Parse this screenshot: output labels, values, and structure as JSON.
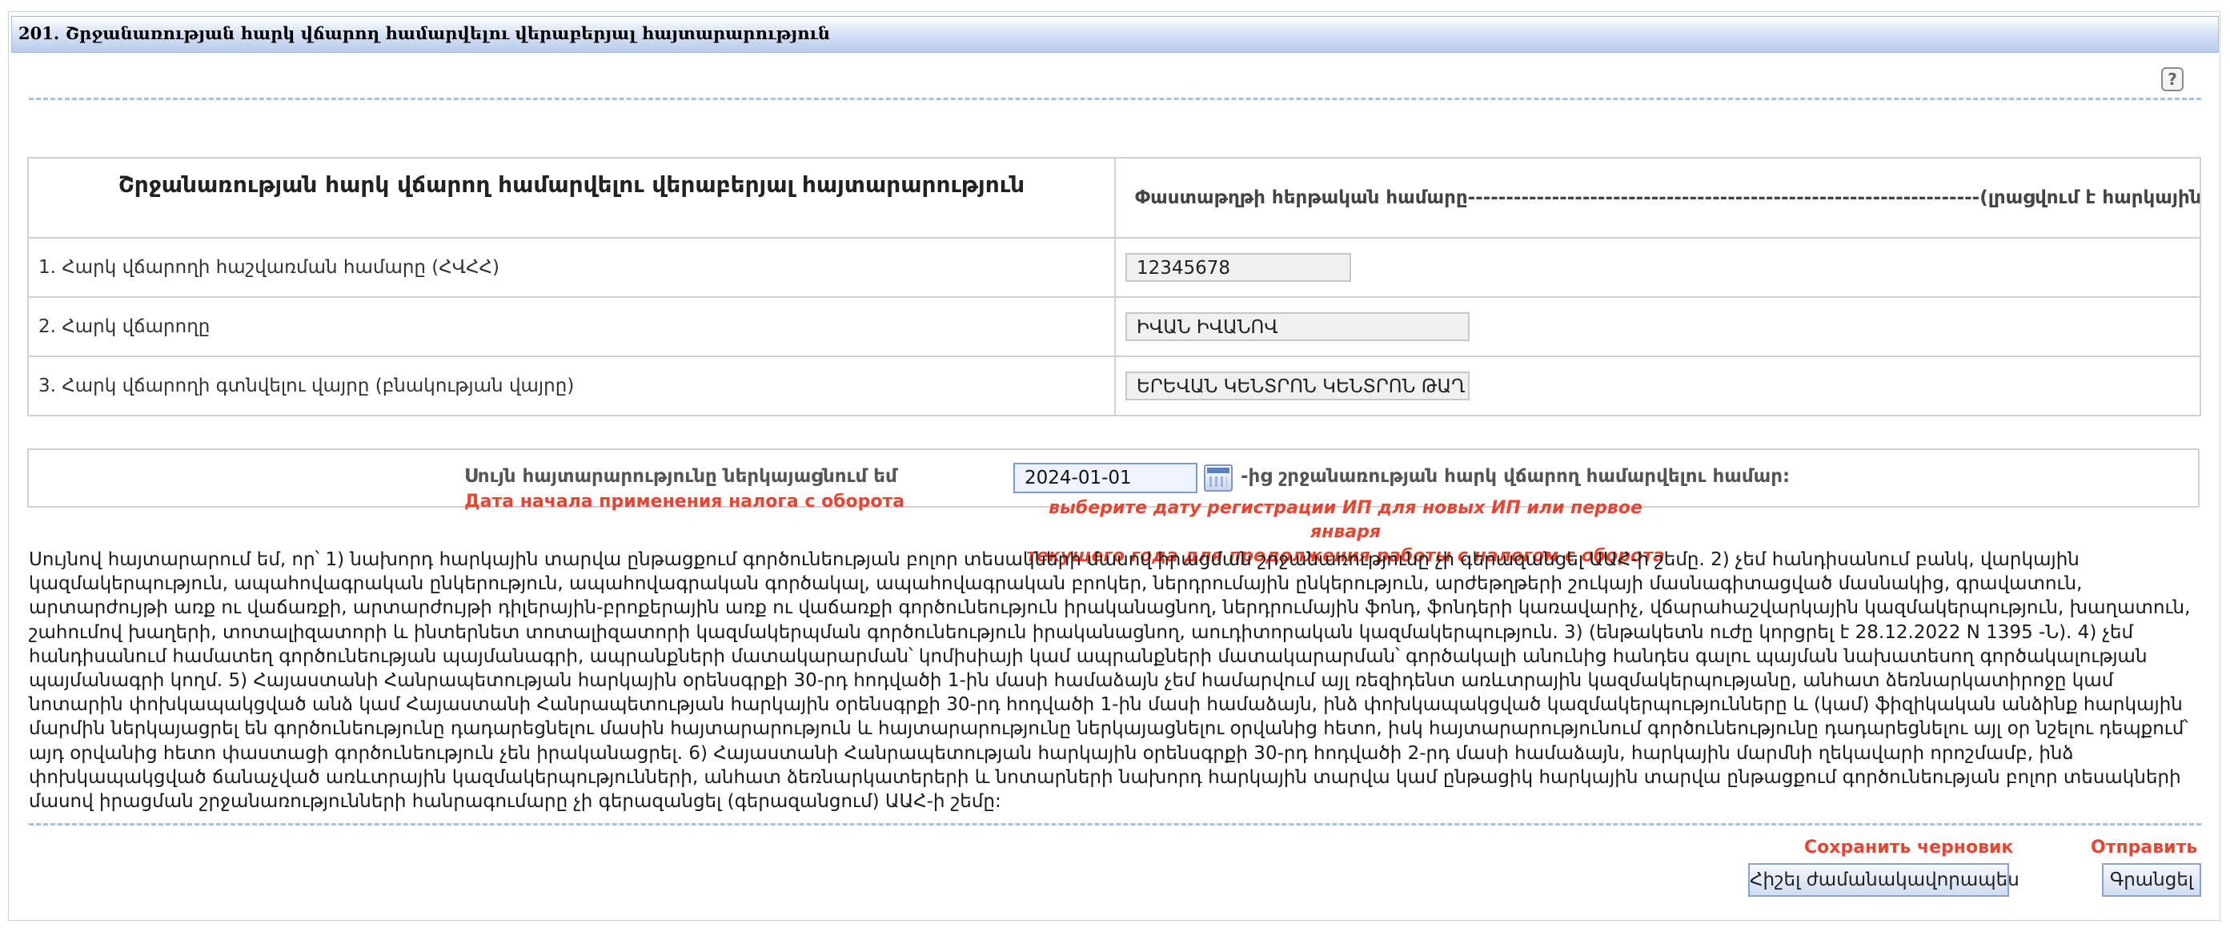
{
  "header": {
    "title": "201. Շրջանառության հարկ վճարող համարվելու վերաբերյալ հայտարարություն"
  },
  "help_icon": "question-help-icon",
  "form": {
    "heading": "Շրջանառության հարկ վճարող համարվելու վերաբերյալ հայտարարություն",
    "document_number_label": "Փաստաթղթի հերթական համարը-------------------------------------------------------------------(լրացվում է հարկային մարմնի կողմից)",
    "rows": [
      {
        "label": "1. Հարկ վճարողի հաշվառման համարը (ՀՎՀՀ)",
        "value": "12345678"
      },
      {
        "label": "2. Հարկ վճարողը",
        "value": "ԻՎԱՆ ԻՎԱՆՈՎ"
      },
      {
        "label": "3. Հարկ վճարողի գտնվելու վայրը (բնակության վայրը)",
        "value": "ԵՐԵՎԱՆ ԿԵՆՏՐՈՆ ԿԵՆՏՐՈՆ ԹԱՂ"
      }
    ]
  },
  "declaration": {
    "label": "Սույն հայտարարությունը ներկայացնում եմ",
    "label_hint": "Дата начала применения налога с оборота",
    "date_value": "2024-01-01",
    "date_suffix": "-ից շրջանառության հարկ վճարող համարվելու համար:",
    "date_hint_line1": "выберите дату регистрации ИП для новых ИП или первое января",
    "date_hint_line2": "текущего года для продолжения работы с налогом с оборота"
  },
  "confirmation_text": "Սույնով հայտարարում եմ, որ՝ 1) նախորդ հարկային տարվա ընթացքում գործունեության բոլոր տեսակների մասով իրացման շրջանառությունը չի գերազանցել ԱԱՀ-ի շեմը. 2) չեմ հանդիսանում բանկ, վարկային կազմակերպություն, ապահովագրական ընկերություն, ապահովագրական գործակալ, ապահովագրական բրոկեր, ներդրումային ընկերություն, արժեթղթերի շուկայի մասնագիտացված մասնակից, գրավատուն, արտարժույթի առք ու վաճառքի, արտարժույթի դիլերային-բրոքերային առք ու վաճառքի գործունեություն իրականացնող, ներդրումային ֆոնդ, ֆոնդերի կառավարիչ, վճարահաշվարկային կազմակերպություն, խաղատուն, շահումով խաղերի, տոտալիզատորի և ինտերնետ տոտալիզատորի կազմակերպման գործունեություն իրականացնող, աուդիտորական կազմակերպություն. 3) (ենթակետն ուժը կորցրել է 28.12.2022 N 1395 -Ն). 4) չեմ հանդիսանում համատեղ գործունեության պայմանագրի, ապրանքների մատակարարման՝ կոմիսիայի կամ ապրանքների մատակարարման՝ գործակալի անունից հանդես գալու պայման նախատեսող գործակալության պայմանագրի կողմ. 5) Հայաստանի Հանրապետության հարկային օրենսգրքի 30-րդ հոդվածի 1-ին մասի համաձայն չեմ համարվում այլ ռեզիդենտ առևտրային կազմակերպությանը, անհատ ձեռնարկատիրոջը կամ նոտարին փոխկապակցված անձ կամ Հայաստանի Հանրապետության հարկային օրենսգրքի 30-րդ հոդվածի 1-ին մասի համաձայն, ինձ փոխկապակցված կազմակերպությունները և (կամ) ֆիզիկական անձինք հարկային մարմին ներկայացրել են գործունեությունը դադարեցնելու մասին հայտարարություն և հայտարարությունը ներկայացնելու օրվանից հետո, իսկ հայտարարությունում գործունեությունը դադարեցնելու այլ օր նշելու դեպքում՝ այդ օրվանից հետո փաստացի գործունեություն չեն իրականացրել. 6) Հայաստանի Հանրապետության հարկային օրենսգրքի 30-րդ հոդվածի 2-րդ մասի համաձայն, հարկային մարմնի ղեկավարի որոշմամբ, ինձ փոխկապակցված ճանաչված առևտրային կազմակերպությունների, անհատ ձեռնարկատերերի և նոտարների նախորդ հարկային տարվա կամ ընթացիկ հարկային տարվա ընթացքում գործունեության բոլոր տեսակների մասով իրացման շրջանառությունների հանրագումարը չի գերազանցել (գերազանցում) ԱԱՀ-ի շեմը:",
  "actions": {
    "draft_hint": "Сохранить черновик",
    "send_hint": "Отправить",
    "draft_button": "Հիշել ժամանակավորապես",
    "submit_button": "Գրանցել"
  },
  "colors": {
    "hint_red": "#e8442f",
    "title_bar": "#c7d6f1",
    "border": "#d2d2d2"
  }
}
